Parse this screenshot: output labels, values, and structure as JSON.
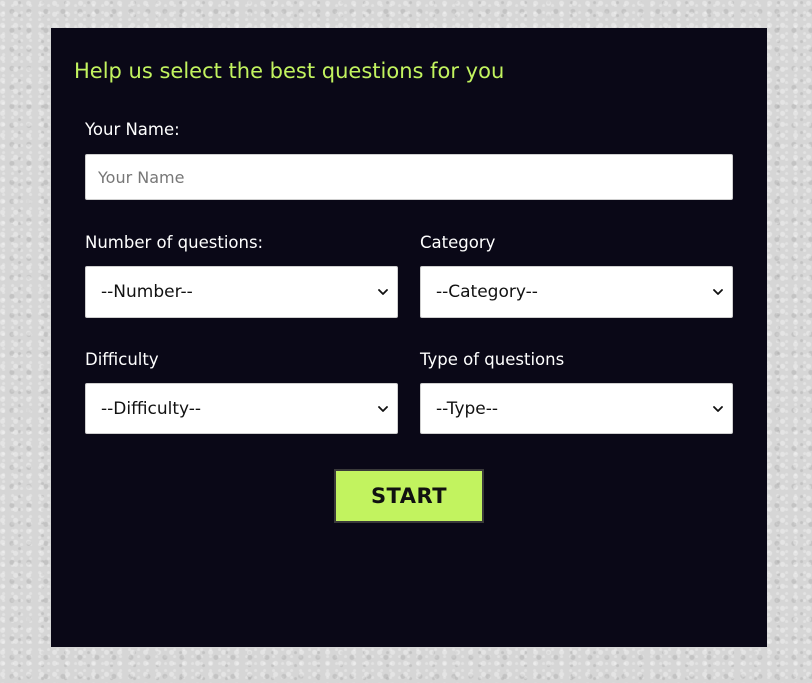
{
  "form": {
    "heading": "Help us select the best questions for you",
    "name_label": "Your Name:",
    "name_placeholder": "Your Name",
    "name_value": "",
    "number_label": "Number of questions:",
    "number_selected": "--Number--",
    "category_label": "Category",
    "category_selected": "--Category--",
    "difficulty_label": "Difficulty",
    "difficulty_selected": "--Difficulty--",
    "type_label": "Type of questions",
    "type_selected": "--Type--",
    "start_label": "START"
  },
  "colors": {
    "accent": "#c2f35f",
    "panel_background": "#0a0817",
    "page_background": "#d6d6d6"
  },
  "icons": {
    "dropdown": "chevron-down-icon"
  }
}
